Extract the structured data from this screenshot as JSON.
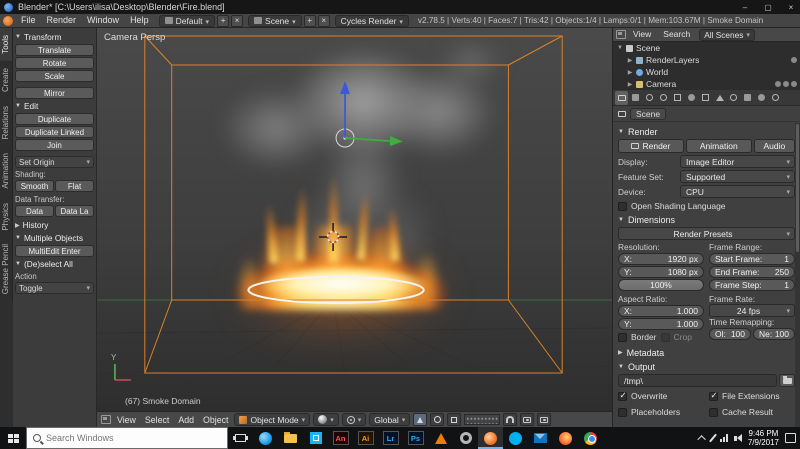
{
  "titlebar": {
    "title": "Blender* [C:\\Users\\ilisa\\Desktop\\Blender\\Fire.blend]",
    "minimize": "–",
    "maximize": "▢",
    "close": "×"
  },
  "infobar": {
    "menus": [
      "File",
      "Render",
      "Window",
      "Help"
    ],
    "layout_value": "Default",
    "scene_value": "Scene",
    "engine_value": "Cycles Render",
    "add_glyph": "+",
    "remove_glyph": "×",
    "stats": "v2.78.5 | Verts:40 | Faces:7 | Tris:42 | Objects:1/4 | Lamps:0/1 | Mem:103.67M | Smoke Domain"
  },
  "tool_tabs": [
    {
      "label": "Tools"
    },
    {
      "label": "Create"
    },
    {
      "label": "Relations"
    },
    {
      "label": "Animation"
    },
    {
      "label": "Physics"
    },
    {
      "label": "Grease Pencil"
    }
  ],
  "tool_shelf": {
    "transform_header": "Transform",
    "translate": "Translate",
    "rotate": "Rotate",
    "scale": "Scale",
    "mirror": "Mirror",
    "edit_header": "Edit",
    "duplicate": "Duplicate",
    "duplicate_linked": "Duplicate Linked",
    "join": "Join",
    "set_origin": "Set Origin",
    "shading_label": "Shading:",
    "smooth": "Smooth",
    "flat": "Flat",
    "data_transfer_label": "Data Transfer:",
    "data_btn": "Data",
    "data_la_btn": "Data La",
    "history_header": "History",
    "multiple_objects_header": "Multiple Objects",
    "multiedit_btn": "MultiEdit Enter",
    "deselect_header": "(De)select All",
    "action_label": "Action",
    "action_value": "Toggle"
  },
  "viewport": {
    "view_label": "Camera Persp",
    "object_label": "(67) Smoke Domain",
    "axis_y_label": "Y",
    "header": {
      "menus": [
        "View",
        "Select",
        "Add",
        "Object"
      ],
      "mode_value": "Object Mode",
      "orientation_value": "Global"
    }
  },
  "outliner": {
    "menus": [
      "View",
      "Search"
    ],
    "filter_value": "All Scenes",
    "items": [
      {
        "label": "Scene"
      },
      {
        "label": "RenderLayers"
      },
      {
        "label": "World"
      },
      {
        "label": "Camera"
      }
    ]
  },
  "properties": {
    "breadcrumb_scene": "Scene",
    "render_header": "Render",
    "render_btn": "Render",
    "animation_btn": "Animation",
    "audio_btn": "Audio",
    "display_label": "Display:",
    "display_value": "Image Editor",
    "feature_label": "Feature Set:",
    "feature_value": "Supported",
    "device_label": "Device:",
    "device_value": "CPU",
    "osl_label": "Open Shading Language",
    "dimensions_header": "Dimensions",
    "presets_value": "Render Presets",
    "resolution_label": "Resolution:",
    "res_x_label": "X:",
    "res_x_value": "1920 px",
    "res_y_label": "Y:",
    "res_y_value": "1080 px",
    "res_scale_value": "100%",
    "frame_range_label": "Frame Range:",
    "frame_start_label": "Start Frame:",
    "frame_start_value": "1",
    "frame_end_label": "End Frame:",
    "frame_end_value": "250",
    "frame_step_label": "Frame Step:",
    "frame_step_value": "1",
    "aspect_label": "Aspect Ratio:",
    "aspect_x_label": "X:",
    "aspect_x_value": "1.000",
    "aspect_y_label": "Y:",
    "aspect_y_value": "1.000",
    "framerate_label": "Frame Rate:",
    "framerate_value": "24 fps",
    "remap_label": "Time Remapping:",
    "remap_old_label": "Ol:",
    "remap_old_value": "100",
    "remap_new_label": "Ne:",
    "remap_new_value": "100",
    "border_label": "Border",
    "crop_label": "Crop",
    "metadata_header": "Metadata",
    "output_header": "Output",
    "output_path": "/tmp\\",
    "overwrite_label": "Overwrite",
    "file_ext_label": "File Extensions",
    "placeholders_label": "Placeholders",
    "cache_label": "Cache Result"
  },
  "taskbar": {
    "search_placeholder": "Search Windows",
    "adobe_tiles": [
      {
        "label": "An",
        "color": "#ff4f4f"
      },
      {
        "label": "Ai",
        "color": "#ff9a00"
      },
      {
        "label": "Lr",
        "color": "#31a8ff"
      },
      {
        "label": "Ps",
        "color": "#31a8ff"
      }
    ],
    "time": "9:46 PM",
    "date": "7/9/2017"
  },
  "colors": {
    "selection_orange": "#d9822b",
    "axis_green": "#3fae3f",
    "axis_blue": "#3b5bd6",
    "fire_core": "#fff6c8",
    "fire_orange": "#ff8a1e",
    "smoke_gray": "#9a9a9a",
    "taskbar_active_accent": "#6fb3e8"
  }
}
